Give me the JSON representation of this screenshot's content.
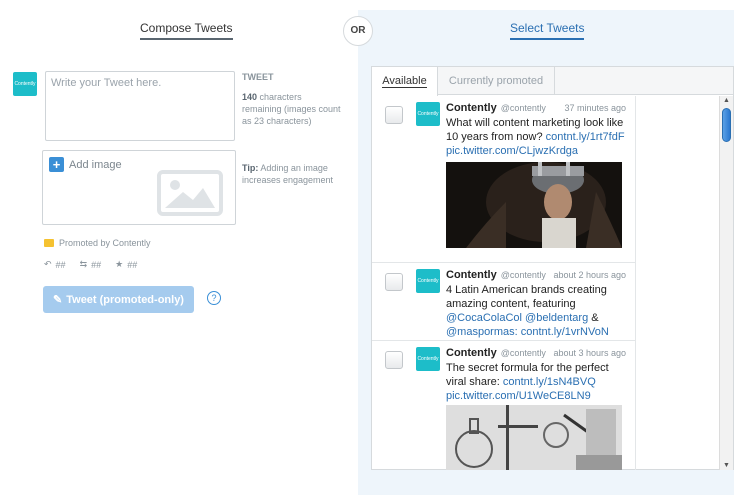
{
  "compose": {
    "title": "Compose Tweets",
    "avatar_label": "Contently",
    "tweet_placeholder": "Write your Tweet here.",
    "tweet_heading": "TWEET",
    "chars_count": "140",
    "chars_text": "characters remaining (images count as 23 characters)",
    "add_image_label": "Add image",
    "tip_label": "Tip:",
    "tip_text": "Adding an image increases engagement",
    "promoted_label": "Promoted by Contently",
    "stats": {
      "replies": "##",
      "retweets": "##",
      "favorites": "##"
    },
    "tweet_button_label": "Tweet (promoted-only)",
    "help_label": "?"
  },
  "or_label": "OR",
  "select": {
    "title": "Select Tweets",
    "tabs": [
      "Available",
      "Currently promoted"
    ],
    "tweets": [
      {
        "avatar_label": "Contently",
        "name": "Contently",
        "handle": "@contently",
        "time": "37 minutes ago",
        "text": "What will content marketing look like 10 years from now?",
        "link1": "contnt.ly/1rt7fdF",
        "link2": "pic.twitter.com/CLjwzKrdga"
      },
      {
        "avatar_label": "Contently",
        "name": "Contently",
        "handle": "@contently",
        "time": "about 2 hours ago",
        "text": "4 Latin American brands creating amazing content, featuring",
        "link1": "@CocaColaCol",
        "link2": "@beldentarg",
        "amp": "&",
        "link3": "@maspormas:",
        "link4": "contnt.ly/1vrNVoN"
      },
      {
        "avatar_label": "Contently",
        "name": "Contently",
        "handle": "@contently",
        "time": "about 3 hours ago",
        "text": "The secret formula for the perfect viral share:",
        "link1": "contnt.ly/1sN4BVQ",
        "link2": "pic.twitter.com/U1WeCE8LN9"
      }
    ]
  },
  "colors": {
    "brand_teal": "#1dbdc9",
    "link_blue": "#2a6fb2",
    "button_disabled": "#a5cbee",
    "promo_yellow": "#f5c231"
  }
}
